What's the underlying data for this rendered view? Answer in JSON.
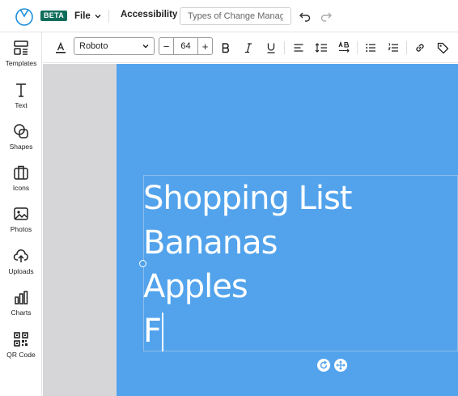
{
  "app": {
    "beta_badge": "BETA",
    "file_menu_label": "File",
    "accessibility_label": "Accessibility",
    "document_title": {
      "value": "",
      "placeholder": "Types of Change Manag..."
    }
  },
  "sidebar": {
    "items": [
      {
        "label": "Templates",
        "icon": "templates-icon"
      },
      {
        "label": "Text",
        "icon": "text-icon"
      },
      {
        "label": "Shapes",
        "icon": "shapes-icon"
      },
      {
        "label": "Icons",
        "icon": "icons-icon"
      },
      {
        "label": "Photos",
        "icon": "photos-icon"
      },
      {
        "label": "Uploads",
        "icon": "upload-cloud-icon"
      },
      {
        "label": "Charts",
        "icon": "bar-chart-icon"
      },
      {
        "label": "QR Code",
        "icon": "qr-code-icon"
      }
    ]
  },
  "toolbar": {
    "font_family": "Roboto",
    "font_size": "64",
    "decrement_label": "−",
    "increment_label": "+",
    "buttons": [
      "text-color",
      "bold",
      "italic",
      "underline",
      "align",
      "line-height",
      "letter-spacing",
      "bullet-list",
      "numbered-list",
      "link",
      "tag"
    ]
  },
  "canvas": {
    "background_color": "#52a3ec",
    "workspace_color": "#d6d6d8",
    "text_lines": [
      "Shopping List",
      "Bananas",
      "Apples",
      "F"
    ]
  },
  "colors": {
    "brand_badge": "#0f6d5b",
    "logo": "#1f8fdc",
    "text": "#ffffff"
  }
}
